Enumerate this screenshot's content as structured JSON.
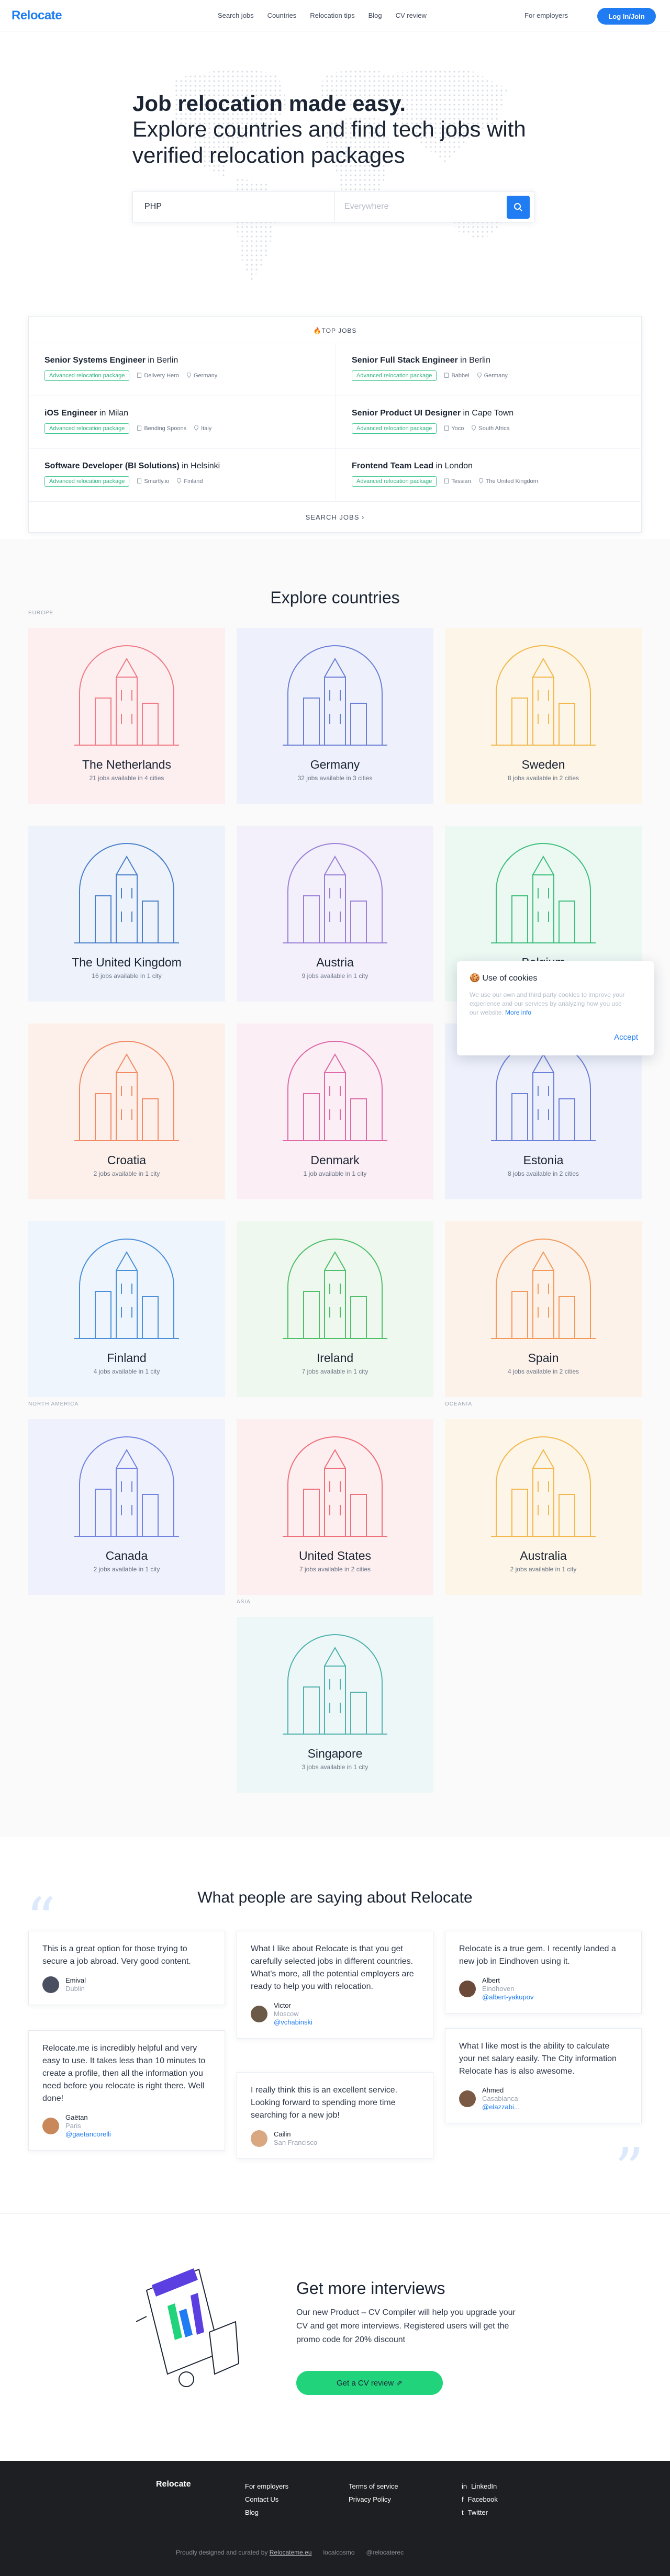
{
  "nav": {
    "logo": "Relocate",
    "links": [
      "Search jobs",
      "Countries",
      "Relocation tips",
      "Blog",
      "CV review"
    ],
    "employers": "For employers",
    "login": "Log In/Join"
  },
  "hero": {
    "title": "Job relocation made easy.",
    "subtitle": "Explore countries and find tech jobs with verified relocation packages",
    "search_value": "PHP",
    "location_placeholder": "Everywhere"
  },
  "top_jobs": {
    "heading": "TOP JOBS",
    "jobs": [
      {
        "title": "Senior Systems Engineer",
        "prep": "in",
        "city": "Berlin",
        "badge": "Advanced relocation package",
        "company": "Delivery Hero",
        "country": "Germany"
      },
      {
        "title": "Senior Full Stack Engineer",
        "prep": "in",
        "city": "Berlin",
        "badge": "Advanced relocation package",
        "company": "Babbel",
        "country": "Germany"
      },
      {
        "title": "iOS Engineer",
        "prep": "in",
        "city": "Milan",
        "badge": "Advanced relocation package",
        "company": "Bending Spoons",
        "country": "Italy"
      },
      {
        "title": "Senior Product UI Designer",
        "prep": "in",
        "city": "Cape Town",
        "badge": "Advanced relocation package",
        "company": "Yoco",
        "country": "South Africa"
      },
      {
        "title": "Software Developer (BI Solutions)",
        "prep": "in",
        "city": "Helsinki",
        "badge": "Advanced relocation package",
        "company": "Smartly.io",
        "country": "Finland"
      },
      {
        "title": "Frontend Team Lead",
        "prep": "in",
        "city": "London",
        "badge": "Advanced relocation package",
        "company": "Tessian",
        "country": "The United Kingdom"
      }
    ],
    "more": "SEARCH JOBS"
  },
  "countries": {
    "heading": "Explore countries",
    "regions": {
      "europe": "EUROPE",
      "north_america": "NORTH AMERICA",
      "oceania": "OCEANIA",
      "asia": "ASIA"
    },
    "items": [
      {
        "name": "The Netherlands",
        "jobs": "21 jobs available in 4 cities",
        "bg": "#fdeef0",
        "color": "#f07a85"
      },
      {
        "name": "Germany",
        "jobs": "32 jobs available in 3 cities",
        "bg": "#eef1fb",
        "color": "#6b7fd6"
      },
      {
        "name": "Sweden",
        "jobs": "8 jobs available in 2 cities",
        "bg": "#fdf5e8",
        "color": "#f2b84b"
      },
      {
        "name": "The United Kingdom",
        "jobs": "16 jobs available in 1 city",
        "bg": "#eef3fb",
        "color": "#4a7fc9"
      },
      {
        "name": "Austria",
        "jobs": "9 jobs available in 1 city",
        "bg": "#f3f0fb",
        "color": "#9a7fd6"
      },
      {
        "name": "Belgium",
        "jobs": "",
        "bg": "#ecf8f2",
        "color": "#3dbf7d"
      },
      {
        "name": "Croatia",
        "jobs": "2 jobs available in 1 city",
        "bg": "#fdf0ea",
        "color": "#f28a66"
      },
      {
        "name": "Denmark",
        "jobs": "1 job available in 1 city",
        "bg": "#fbeef5",
        "color": "#dd6aa7"
      },
      {
        "name": "Estonia",
        "jobs": "8 jobs available in 2 cities",
        "bg": "#eef1fb",
        "color": "#6b7fd6"
      },
      {
        "name": "Finland",
        "jobs": "4 jobs available in 1 city",
        "bg": "#eef5fc",
        "color": "#4a8fd8"
      },
      {
        "name": "Ireland",
        "jobs": "7 jobs available in 1 city",
        "bg": "#eff8ee",
        "color": "#4fbf6a"
      },
      {
        "name": "Spain",
        "jobs": "4 jobs available in 2 cities",
        "bg": "#fdf2ea",
        "color": "#f29a5b"
      },
      {
        "name": "Canada",
        "jobs": "2 jobs available in 1 city",
        "bg": "#eff1fc",
        "color": "#7182e0"
      },
      {
        "name": "United States",
        "jobs": "7 jobs available in 2 cities",
        "bg": "#fdeef0",
        "color": "#ef6f7a"
      },
      {
        "name": "Australia",
        "jobs": "2 jobs available in 1 city",
        "bg": "#fdf5e8",
        "color": "#f2b84b"
      },
      {
        "name": "Singapore",
        "jobs": "3 jobs available in 1 city",
        "bg": "#eef7f7",
        "color": "#4fb2ad"
      }
    ]
  },
  "testimonials": {
    "heading": "What people are saying about Relocate",
    "items": [
      {
        "text": "This is a great option for those trying to secure a job abroad. Very good content.",
        "name": "Emival",
        "city": "Dublin",
        "handle": ""
      },
      {
        "text": "Relocate.me is incredibly helpful and very easy to use. It takes less than 10 minutes to create a profile, then all the information you need before you relocate is right there. Well done!",
        "name": "Gaëtan",
        "city": "Paris",
        "handle": "@gaetancorelli"
      },
      {
        "text": "What I like about Relocate is that you get carefully selected jobs in different countries. What's more, all the potential employers are ready to help you with relocation.",
        "name": "Victor",
        "city": "Moscow",
        "handle": "@vchabinski"
      },
      {
        "text": "I really think this is an excellent service. Looking forward to spending more time searching for a new job!",
        "name": "Cailin",
        "city": "San Francisco",
        "handle": ""
      },
      {
        "text": "Relocate is a true gem. I recently landed a new job in Eindhoven using it.",
        "name": "Albert",
        "city": "Eindhoven",
        "handle": "@albert-yakupov"
      },
      {
        "text": "What I like most is the ability to calculate your net salary easily. The City information Relocate has is also awesome.",
        "name": "Ahmed",
        "city": "Casablanca",
        "handle": "@elazzabi..."
      }
    ]
  },
  "promo": {
    "title": "Get more interviews",
    "text": "Our new Product – CV Compiler will help you upgrade your CV and get more interviews. Registered users will get the promo code for 20% discount",
    "cta": "Get a CV review"
  },
  "footer": {
    "logo": "Relocate",
    "col1": [
      "For employers",
      "Contact Us",
      "Blog"
    ],
    "col2": [
      "Terms of service",
      "Privacy Policy"
    ],
    "col3": [
      "LinkedIn",
      "Facebook",
      "Twitter"
    ],
    "credit_prefix": "Proudly designed and curated by",
    "credit_link": "Relocateme.eu",
    "partner1": "localcosmo",
    "partner2": "@relocaterec"
  },
  "cookie": {
    "title": "Use of cookies",
    "body": "We use our own and third party cookies to improve your experience and our services by analyzing how you use our website.",
    "more": "More info",
    "accept": "Accept"
  },
  "colors": {
    "accent": "#1f7cf2",
    "green": "#21d47c",
    "badge": "#3bc48e",
    "footer_bg": "#1d1f22"
  }
}
